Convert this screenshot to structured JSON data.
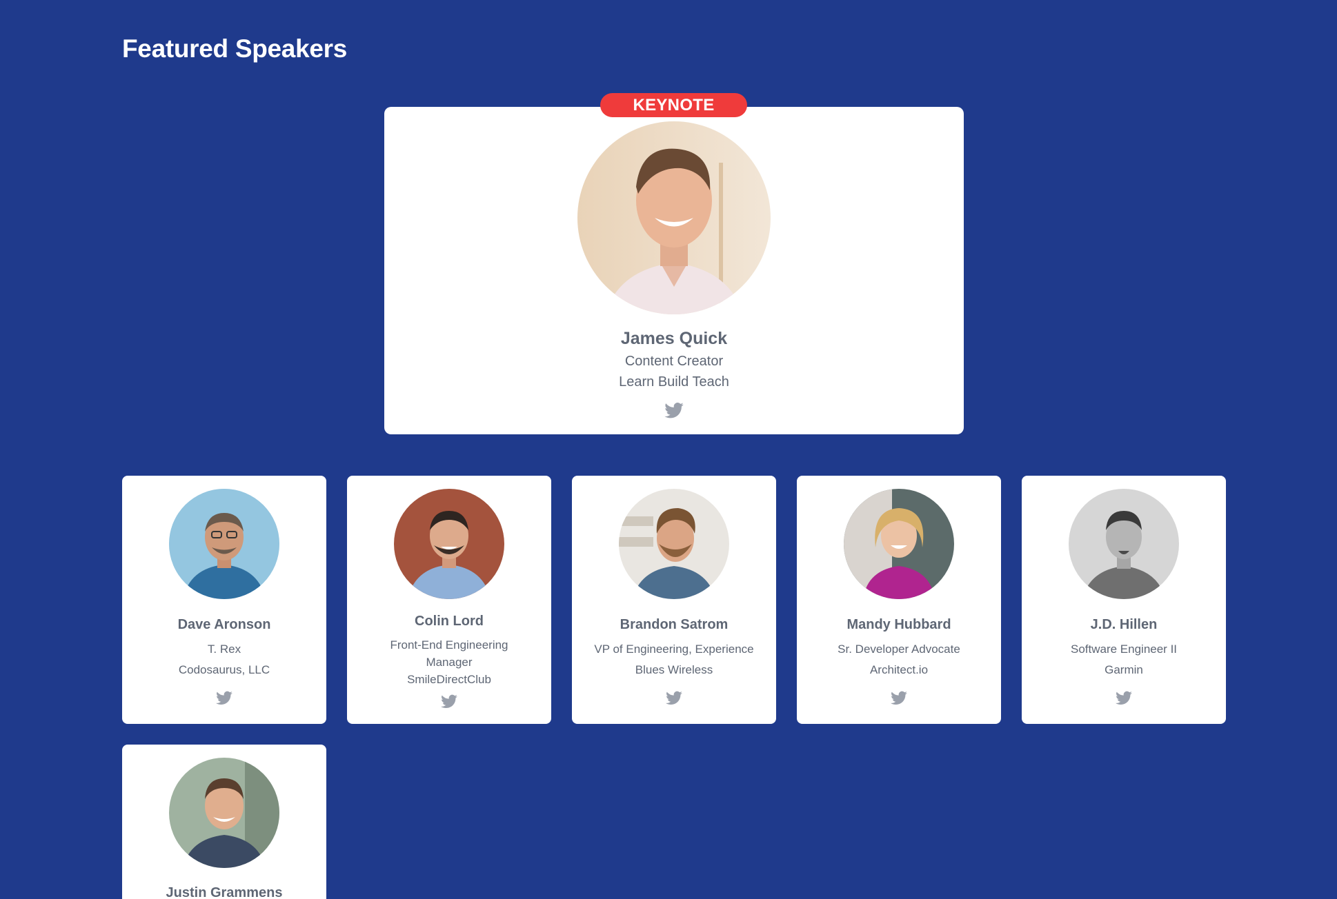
{
  "section": {
    "title": "Featured Speakers"
  },
  "keynote": {
    "badge": "KEYNOTE",
    "name": "James Quick",
    "title": "Content Creator",
    "company": "Learn Build Teach"
  },
  "speakers": [
    {
      "name": "Dave Aronson",
      "title": "T. Rex",
      "company": "Codosaurus, LLC"
    },
    {
      "name": "Colin Lord",
      "title_line1": "Front-End Engineering",
      "title_line2": "Manager",
      "company": "SmileDirectClub"
    },
    {
      "name": "Brandon Satrom",
      "title": "VP of Engineering, Experience",
      "company": "Blues Wireless"
    },
    {
      "name": "Mandy Hubbard",
      "title": "Sr. Developer Advocate",
      "company": "Architect.io"
    },
    {
      "name": "J.D. Hillen",
      "title": "Software Engineer II",
      "company": "Garmin"
    },
    {
      "name": "Justin Grammens"
    }
  ],
  "icons": {
    "social": "twitter-icon",
    "avatar": "avatar-photo"
  },
  "colors": {
    "background": "#1f3a8c",
    "card": "#ffffff",
    "badge": "#ef3b3b",
    "text": "#5e6674",
    "icon": "#9aa0ab"
  }
}
